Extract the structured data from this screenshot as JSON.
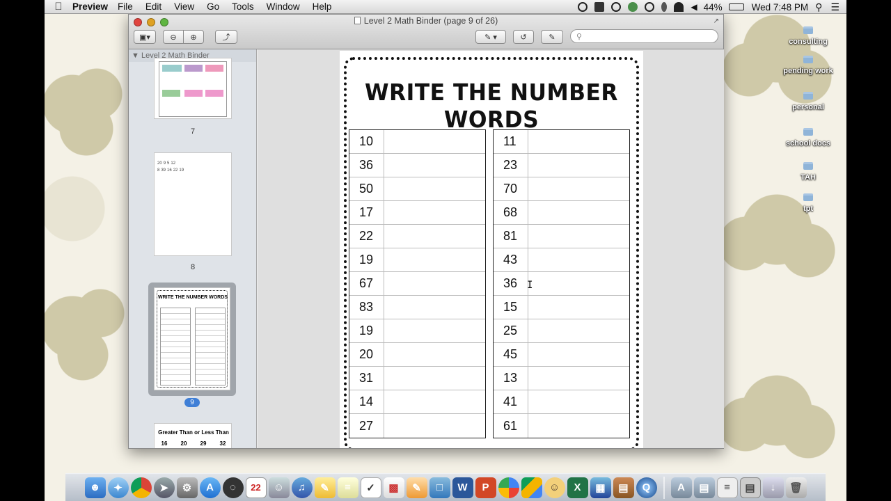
{
  "menubar": {
    "app_name": "Preview",
    "menus": [
      "File",
      "Edit",
      "View",
      "Go",
      "Tools",
      "Window",
      "Help"
    ],
    "battery": "44%",
    "clock": "Wed 7:48 PM"
  },
  "window": {
    "title": "Level 2 Math Binder (page 9 of 26)",
    "search_placeholder": ""
  },
  "sidebar": {
    "header": "Level 2 Math Binder",
    "pages": [
      {
        "label": "7"
      },
      {
        "label": "8",
        "numbers_row1": [
          "20",
          "9",
          "5",
          "12"
        ],
        "numbers_row2": [
          "8",
          "39",
          "16",
          "22",
          "19"
        ]
      },
      {
        "label": "9",
        "title": "WRITE THE NUMBER WORDS",
        "selected": true
      },
      {
        "title": "Greater Than or Less Than",
        "numbers": [
          "16",
          "20",
          "29",
          "32"
        ]
      }
    ]
  },
  "worksheet": {
    "title": "WRITE THE NUMBER WORDS",
    "left_column": [
      "10",
      "36",
      "50",
      "17",
      "22",
      "19",
      "67",
      "83",
      "19",
      "20",
      "31",
      "14",
      "27"
    ],
    "right_column": [
      "11",
      "23",
      "70",
      "68",
      "81",
      "43",
      "36",
      "15",
      "25",
      "45",
      "13",
      "41",
      "61"
    ]
  },
  "desktop": {
    "folders": [
      "consulting",
      "pending work",
      "personal",
      "school docs",
      "TAH",
      "tpt"
    ]
  },
  "dock": {
    "badge_calendar": "22"
  }
}
